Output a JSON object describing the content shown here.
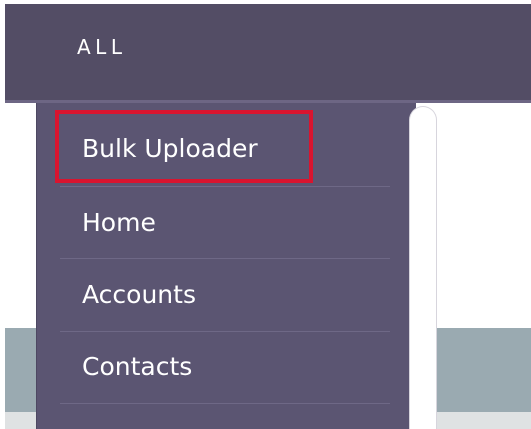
{
  "nav": {
    "all_label": "ALL"
  },
  "menu": {
    "items": [
      {
        "label": "Bulk Uploader",
        "highlighted": true
      },
      {
        "label": "Home"
      },
      {
        "label": "Accounts"
      },
      {
        "label": "Contacts"
      }
    ]
  },
  "colors": {
    "nav_bg": "#534d65",
    "menu_bg": "#5b5572",
    "highlight": "#d9142f",
    "band": "#9aaab1"
  }
}
